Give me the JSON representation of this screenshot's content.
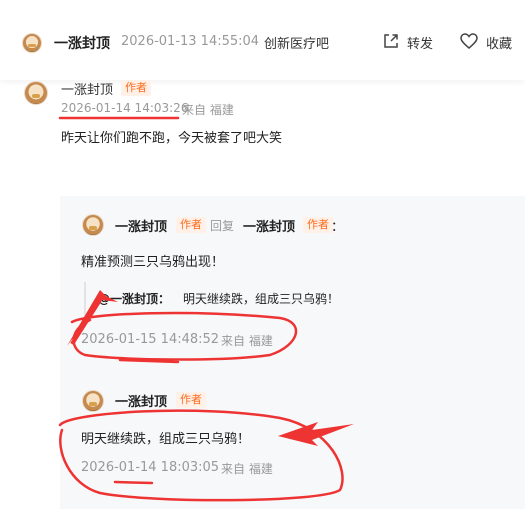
{
  "header": {
    "author": "一涨封顶",
    "timestamp": "2026-01-13 14:55:04",
    "forum": "创新医疗吧",
    "share_label": "转发",
    "favorite_label": "收藏"
  },
  "post": {
    "author": "一涨封顶",
    "author_tag": "作者",
    "timestamp": "2026-01-14 14:03:26",
    "location": "来自 福建",
    "text": "昨天让你们跑不跑，今天被套了吧大笑"
  },
  "replies": [
    {
      "author": "一涨封顶",
      "author_tag": "作者",
      "reply_word": "回复",
      "reply_to": "一涨封顶",
      "reply_to_tag": "作者",
      "colon": "：",
      "text": "精准预测三只乌鸦出现！",
      "quote_prefix": "@一涨封顶：",
      "quote_text": "明天继续跌，组成三只乌鸦！",
      "timestamp": "2026-01-15 14:48:52",
      "location": "来自 福建"
    },
    {
      "author": "一涨封顶",
      "author_tag": "作者",
      "text": "明天继续跌，组成三只乌鸦！",
      "timestamp": "2026-01-14 18:03:05",
      "location": "来自 福建"
    }
  ],
  "icons": {
    "share": "share-icon",
    "favorite": "heart-icon"
  },
  "colors": {
    "author_tag_text": "#ff6a1a",
    "author_tag_bg": "#fff1e8",
    "annotation_red": "#ee3333",
    "meta_gray": "#999999"
  }
}
